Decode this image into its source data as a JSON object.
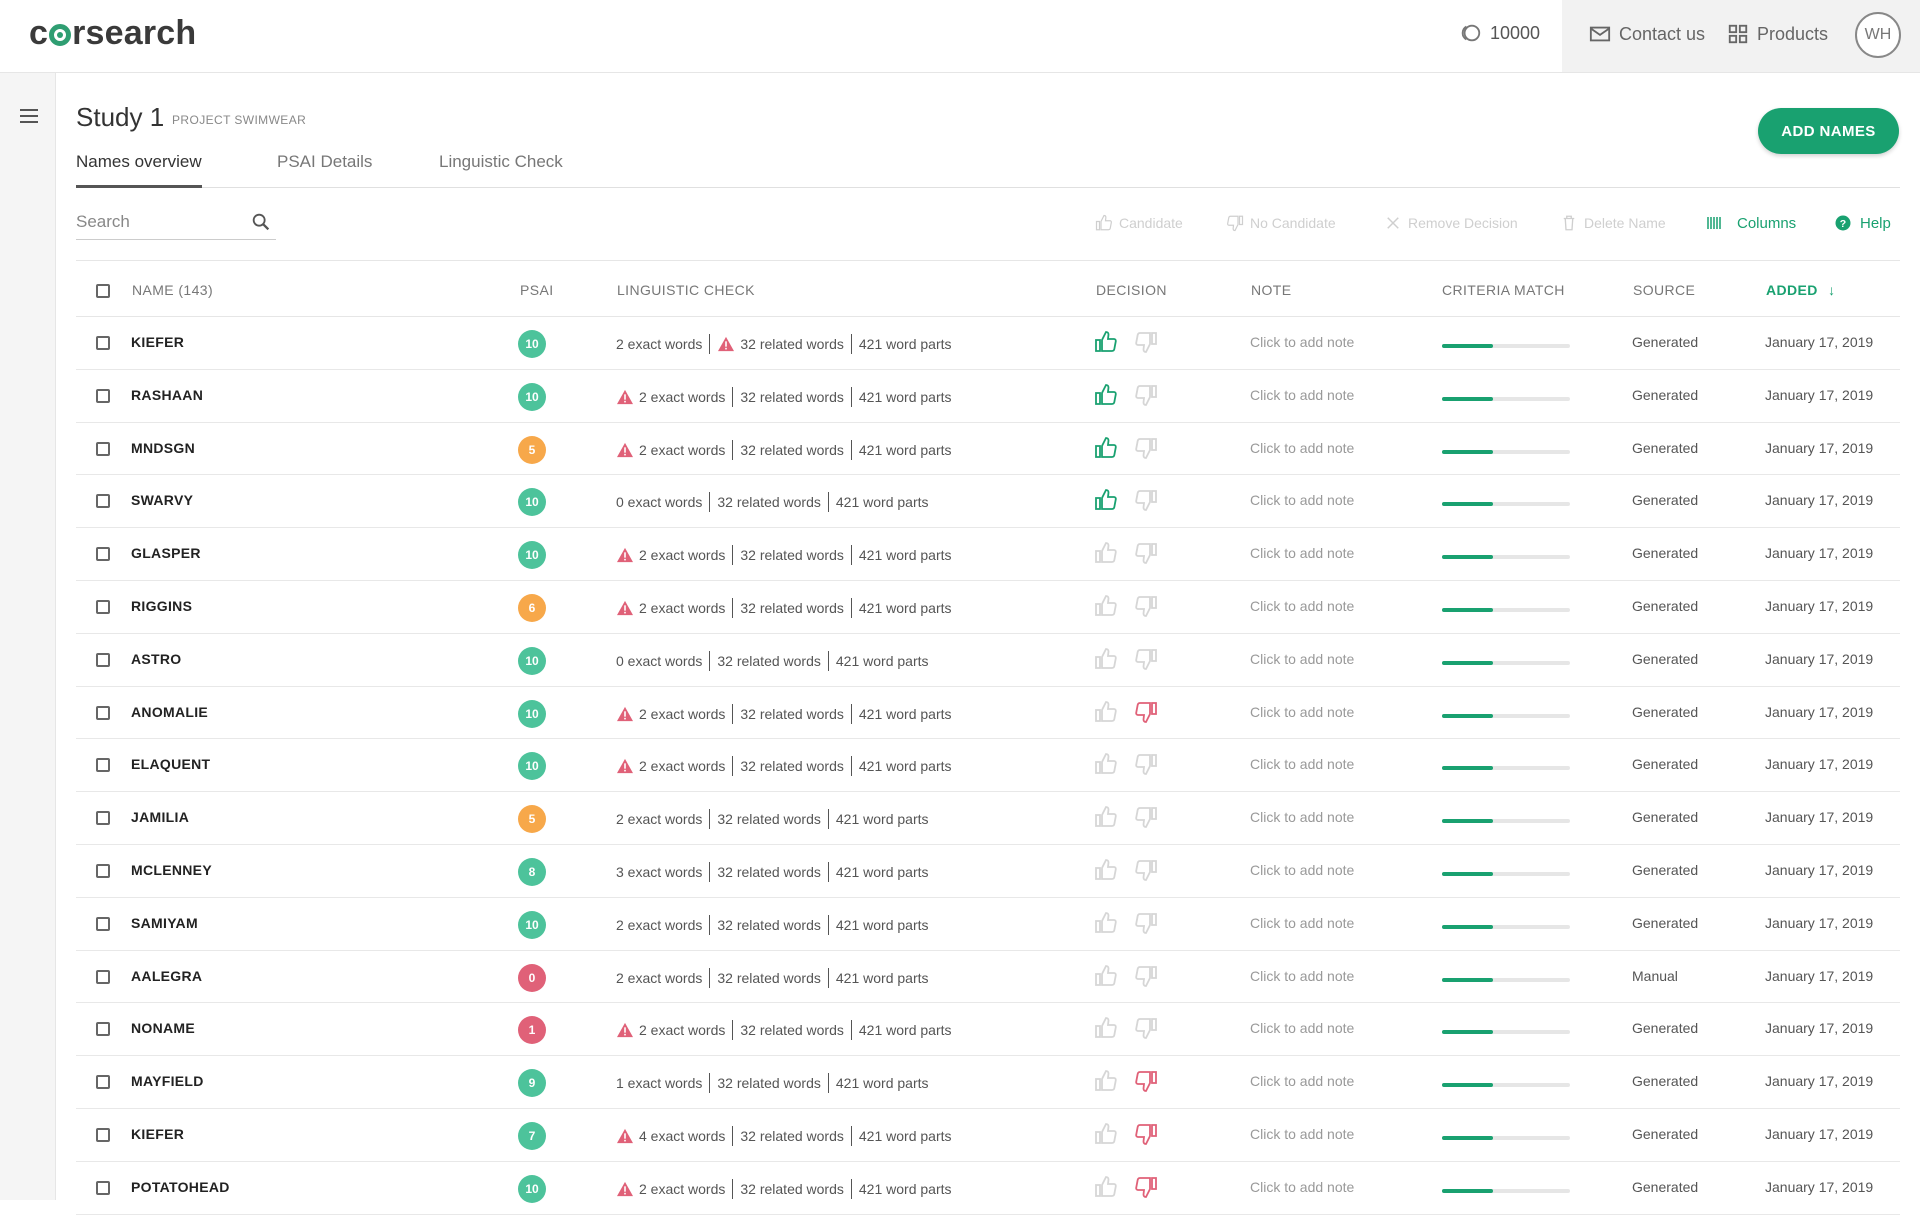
{
  "header": {
    "logo": "corsearch",
    "credits": "10000",
    "contact": "Contact us",
    "products": "Products",
    "avatar": "WH"
  },
  "page": {
    "title": "Study 1",
    "subtitle": "PROJECT SWIMWEAR",
    "add_button": "ADD NAMES",
    "tabs": [
      "Names overview",
      "PSAI Details",
      "Linguistic Check"
    ]
  },
  "toolbar": {
    "search_placeholder": "Search",
    "candidate": "Candidate",
    "no_candidate": "No Candidate",
    "remove_decision": "Remove Decision",
    "delete_name": "Delete Name",
    "columns": "Columns",
    "help": "Help"
  },
  "table": {
    "headers": {
      "name": "NAME (143)",
      "psai": "PSAI",
      "linguistic": "LINGUISTIC CHECK",
      "decision": "DECISION",
      "note": "NOTE",
      "criteria": "CRITERIA MATCH",
      "source": "SOURCE",
      "added": "ADDED"
    },
    "colors": {
      "green": "#4dc39b",
      "orange": "#f7a84a",
      "red": "#e06178",
      "accent": "#19a170"
    },
    "rows": [
      {
        "name": "KIEFER",
        "psai": "10",
        "psai_color": "green",
        "exact": "2 exact words",
        "related": "32 related words",
        "parts": "421 word parts",
        "warn_exact": false,
        "warn_related": true,
        "decision": "up",
        "note": "Click to add note",
        "criteria": 0.4,
        "source": "Generated",
        "added": "January 17, 2019"
      },
      {
        "name": "RASHAAN",
        "psai": "10",
        "psai_color": "green",
        "exact": "2 exact words",
        "related": "32 related words",
        "parts": "421 word parts",
        "warn_exact": true,
        "warn_related": false,
        "decision": "up",
        "note": "Click to add note",
        "criteria": 0.4,
        "source": "Generated",
        "added": "January 17, 2019"
      },
      {
        "name": "MNDSGN",
        "psai": "5",
        "psai_color": "orange",
        "exact": "2 exact words",
        "related": "32 related words",
        "parts": "421 word parts",
        "warn_exact": true,
        "warn_related": false,
        "decision": "up",
        "note": "Click to add note",
        "criteria": 0.4,
        "source": "Generated",
        "added": "January 17, 2019"
      },
      {
        "name": "SWARVY",
        "psai": "10",
        "psai_color": "green",
        "exact": "0 exact words",
        "related": "32 related words",
        "parts": "421 word parts",
        "warn_exact": false,
        "warn_related": false,
        "decision": "up",
        "note": "Click to add note",
        "criteria": 0.4,
        "source": "Generated",
        "added": "January 17, 2019"
      },
      {
        "name": "GLASPER",
        "psai": "10",
        "psai_color": "green",
        "exact": "2 exact words",
        "related": "32 related words",
        "parts": "421 word parts",
        "warn_exact": true,
        "warn_related": false,
        "decision": "none",
        "note": "Click to add note",
        "criteria": 0.4,
        "source": "Generated",
        "added": "January 17, 2019"
      },
      {
        "name": "RIGGINS",
        "psai": "6",
        "psai_color": "orange",
        "exact": "2 exact words",
        "related": "32 related words",
        "parts": "421 word parts",
        "warn_exact": true,
        "warn_related": false,
        "decision": "none",
        "note": "Click to add note",
        "criteria": 0.4,
        "source": "Generated",
        "added": "January 17, 2019"
      },
      {
        "name": "ASTRO",
        "psai": "10",
        "psai_color": "green",
        "exact": "0 exact words",
        "related": "32 related words",
        "parts": "421 word parts",
        "warn_exact": false,
        "warn_related": false,
        "decision": "none",
        "note": "Click to add note",
        "criteria": 0.4,
        "source": "Generated",
        "added": "January 17, 2019"
      },
      {
        "name": "ANOMALIE",
        "psai": "10",
        "psai_color": "green",
        "exact": "2 exact words",
        "related": "32 related words",
        "parts": "421 word parts",
        "warn_exact": true,
        "warn_related": false,
        "decision": "down",
        "note": "Click to add note",
        "criteria": 0.4,
        "source": "Generated",
        "added": "January 17, 2019"
      },
      {
        "name": "ELAQUENT",
        "psai": "10",
        "psai_color": "green",
        "exact": "2 exact words",
        "related": "32 related words",
        "parts": "421 word parts",
        "warn_exact": true,
        "warn_related": false,
        "decision": "none",
        "note": "Click to add note",
        "criteria": 0.4,
        "source": "Generated",
        "added": "January 17, 2019"
      },
      {
        "name": "JAMILIA",
        "psai": "5",
        "psai_color": "orange",
        "exact": "2 exact words",
        "related": "32 related words",
        "parts": "421 word parts",
        "warn_exact": false,
        "warn_related": false,
        "decision": "none",
        "note": "Click to add note",
        "criteria": 0.4,
        "source": "Generated",
        "added": "January 17, 2019"
      },
      {
        "name": "MCLENNEY",
        "psai": "8",
        "psai_color": "green",
        "exact": "3 exact words",
        "related": "32 related words",
        "parts": "421 word parts",
        "warn_exact": false,
        "warn_related": false,
        "decision": "none",
        "note": "Click to add note",
        "criteria": 0.4,
        "source": "Generated",
        "added": "January 17, 2019"
      },
      {
        "name": "SAMIYAM",
        "psai": "10",
        "psai_color": "green",
        "exact": "2 exact words",
        "related": "32 related words",
        "parts": "421 word parts",
        "warn_exact": false,
        "warn_related": false,
        "decision": "none",
        "note": "Click to add note",
        "criteria": 0.4,
        "source": "Generated",
        "added": "January 17, 2019"
      },
      {
        "name": "AALEGRA",
        "psai": "0",
        "psai_color": "red",
        "exact": "2 exact words",
        "related": "32 related words",
        "parts": "421 word parts",
        "warn_exact": false,
        "warn_related": false,
        "decision": "none",
        "note": "Click to add note",
        "criteria": 0.4,
        "source": "Manual",
        "added": "January 17, 2019"
      },
      {
        "name": "NONAME",
        "psai": "1",
        "psai_color": "red",
        "exact": "2 exact words",
        "related": "32 related words",
        "parts": "421 word parts",
        "warn_exact": true,
        "warn_related": false,
        "decision": "none",
        "note": "Click to add note",
        "criteria": 0.4,
        "source": "Generated",
        "added": "January 17, 2019"
      },
      {
        "name": "MAYFIELD",
        "psai": "9",
        "psai_color": "green",
        "exact": "1 exact words",
        "related": "32 related words",
        "parts": "421 word parts",
        "warn_exact": false,
        "warn_related": false,
        "decision": "down",
        "note": "Click to add note",
        "criteria": 0.4,
        "source": "Generated",
        "added": "January 17, 2019"
      },
      {
        "name": "KIEFER",
        "psai": "7",
        "psai_color": "green",
        "exact": "4 exact words",
        "related": "32 related words",
        "parts": "421 word parts",
        "warn_exact": true,
        "warn_related": false,
        "decision": "down",
        "note": "Click to add note",
        "criteria": 0.4,
        "source": "Generated",
        "added": "January 17, 2019"
      },
      {
        "name": "POTATOHEAD",
        "psai": "10",
        "psai_color": "green",
        "exact": "2 exact words",
        "related": "32 related words",
        "parts": "421 word parts",
        "warn_exact": true,
        "warn_related": false,
        "decision": "down",
        "note": "Click to add note",
        "criteria": 0.4,
        "source": "Generated",
        "added": "January 17, 2019"
      }
    ]
  }
}
